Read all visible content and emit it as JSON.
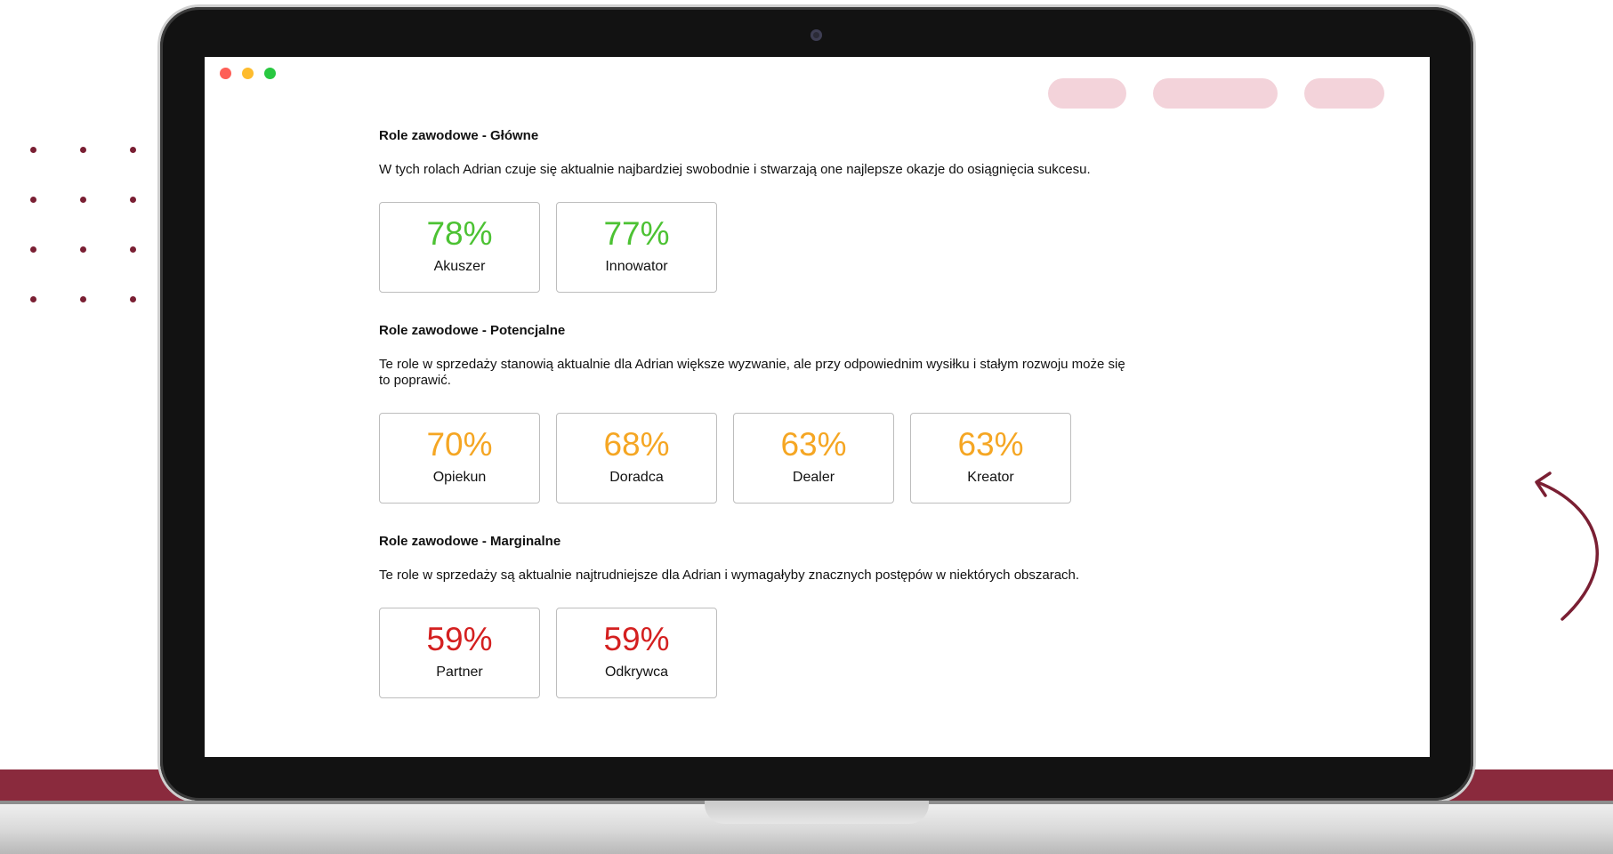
{
  "window": {
    "traffic_colors": [
      "#fe5f57",
      "#febc2e",
      "#28c840"
    ]
  },
  "header": {
    "pill_color": "#f3d3da"
  },
  "colors": {
    "main": "#4cc233",
    "potential": "#f5a623",
    "marginal": "#d42020"
  },
  "sections": [
    {
      "title": "Role zawodowe - Główne",
      "description": "W tych rolach Adrian czuje się aktualnie najbardziej swobodnie i stwarzają one najlepsze okazje do osiągnięcia sukcesu.",
      "color": "#4cc233",
      "cards": [
        {
          "percent": "78%",
          "label": "Akuszer"
        },
        {
          "percent": "77%",
          "label": "Innowator"
        }
      ]
    },
    {
      "title": "Role zawodowe - Potencjalne",
      "description": "Te role w sprzedaży stanowią aktualnie dla Adrian większe wyzwanie, ale przy odpowiednim wysiłku i stałym rozwoju może się to poprawić.",
      "color": "#f5a623",
      "cards": [
        {
          "percent": "70%",
          "label": "Opiekun"
        },
        {
          "percent": "68%",
          "label": "Doradca"
        },
        {
          "percent": "63%",
          "label": "Dealer"
        },
        {
          "percent": "63%",
          "label": "Kreator"
        }
      ]
    },
    {
      "title": "Role zawodowe - Marginalne",
      "description": "Te role w sprzedaży są aktualnie najtrudniejsze dla Adrian i wymagałyby znacznych postępów w niektórych obszarach.",
      "color": "#d42020",
      "cards": [
        {
          "percent": "59%",
          "label": "Partner"
        },
        {
          "percent": "59%",
          "label": "Odkrywca"
        }
      ]
    }
  ]
}
